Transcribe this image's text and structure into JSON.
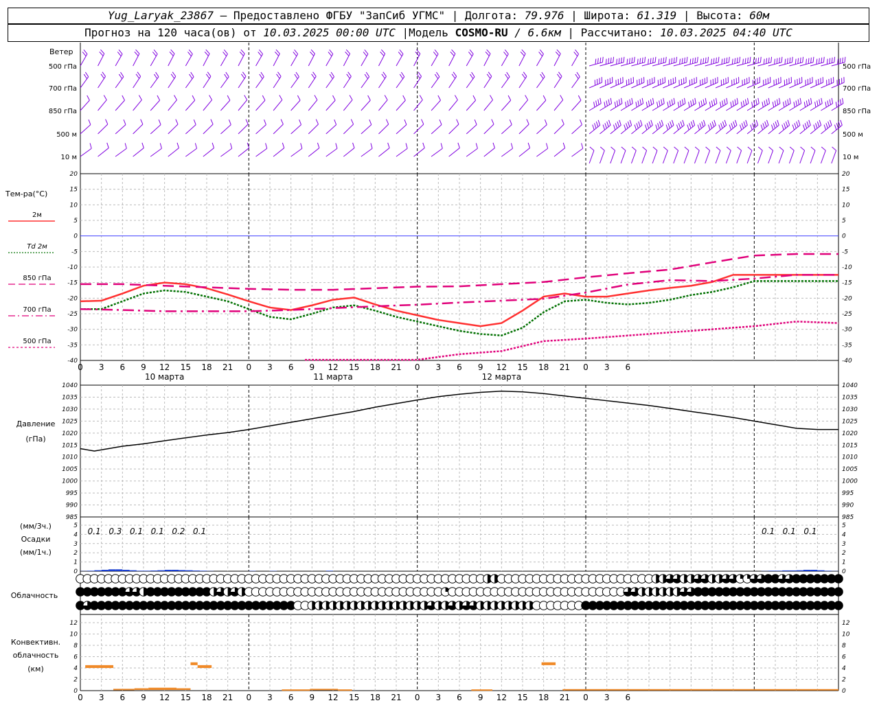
{
  "header": {
    "station": "Yug_Laryak_23867",
    "dash": " — ",
    "provided": "Предоставлено ФГБУ \"ЗапСиб УГМС\"",
    "sep": " | ",
    "lon_label": "Долгота: ",
    "lon_value": "79.976",
    "lat_label": "Широта: ",
    "lat_value": "61.319",
    "alt_label": "Высота: ",
    "alt_value": "60м",
    "forecast_label": "Прогноз на 120 часа(ов) от ",
    "forecast_start": "10.03.2025 00:00 UTC",
    "model_label": "  |Модель ",
    "model_name": "COSMO-RU",
    "model_res_sep": " / ",
    "model_res": "6.6км",
    "calc_label": " | Рассчитано: ",
    "calc_time": "10.03.2025 04:40 UTC"
  },
  "colors": {
    "t2m": "#ff3030",
    "td": "#007000",
    "t850": "#e0007a",
    "t700": "#e0007a",
    "t500": "#e0007a",
    "pressure": "#000000",
    "precip": "#1a3fd0",
    "conv": "#f08a28",
    "wind": "#8000e0",
    "zero": "#4040ff"
  },
  "time_axis": {
    "tick_labels": [
      "0",
      "3",
      "6",
      "9",
      "12",
      "15",
      "18",
      "21",
      "0",
      "3",
      "6",
      "9",
      "12",
      "15",
      "18",
      "21",
      "0",
      "3",
      "6",
      "9",
      "12",
      "15",
      "18",
      "21",
      "0",
      "3",
      "6"
    ],
    "day_labels": [
      "10 марта",
      "11 марта",
      "12 марта"
    ]
  },
  "wind_panel": {
    "title": "Ветер",
    "levels": [
      "500 гПа",
      "700 гПа",
      "850 гПа",
      "500 м",
      "10  м"
    ]
  },
  "temp_panel": {
    "title": "Тем-ра(°C)",
    "legend": [
      {
        "label": "2м",
        "style": "solid",
        "color": "#ff3030"
      },
      {
        "label": "Td  2м",
        "style": "dotted",
        "color": "#007000"
      },
      {
        "label": "850 гПа",
        "style": "dash",
        "color": "#e0007a"
      },
      {
        "label": "700 гПа",
        "style": "dashdot",
        "color": "#e0007a"
      },
      {
        "label": "500 гПа",
        "style": "dot",
        "color": "#e0007a"
      }
    ],
    "y_ticks": [
      "20",
      "15",
      "10",
      "5",
      "0",
      "-5",
      "-10",
      "-15",
      "-20",
      "-25",
      "-30",
      "-35",
      "-40"
    ]
  },
  "pressure_panel": {
    "title_1": "Давление",
    "title_2": "(гПа)",
    "y_ticks": [
      "1040",
      "1035",
      "1030",
      "1025",
      "1020",
      "1015",
      "1010",
      "1005",
      "1000",
      "995",
      "990",
      "985"
    ]
  },
  "precip_panel": {
    "title_1": "(мм/3ч.)",
    "title_2": "Осадки",
    "title_3": "(мм/1ч.)",
    "y_ticks": [
      "5",
      "4",
      "3",
      "2",
      "1",
      "0"
    ],
    "labels": [
      {
        "h": 1,
        "text": "0.1"
      },
      {
        "h": 4,
        "text": "0.3"
      },
      {
        "h": 7,
        "text": "0.1"
      },
      {
        "h": 10,
        "text": "0.1"
      },
      {
        "h": 13,
        "text": "0.2"
      },
      {
        "h": 16,
        "text": "0.1"
      },
      {
        "h": 97,
        "text": "0.1"
      },
      {
        "h": 100,
        "text": "0.1"
      },
      {
        "h": 103,
        "text": "0.1"
      }
    ]
  },
  "cloud_panel": {
    "title": "Облачность"
  },
  "conv_panel": {
    "title_1": "Конвективн.",
    "title_2": "облачность",
    "title_3": "(км)",
    "y_ticks": [
      "12",
      "10",
      "8",
      "6",
      "4",
      "2",
      "0"
    ]
  },
  "chart_data": [
    {
      "type": "line",
      "title": "Тем-ра(°C)",
      "x_unit": "hours from 10.03.2025 00:00 UTC",
      "ylim": [
        -40,
        20
      ],
      "grid": true,
      "series": [
        {
          "name": "2м",
          "x": [
            0,
            3,
            6,
            9,
            12,
            15,
            18,
            21,
            24,
            27,
            30,
            33,
            36,
            39,
            42,
            45,
            48,
            51,
            54,
            57,
            60,
            63,
            66,
            69,
            72,
            75,
            78,
            81,
            84,
            87,
            90,
            93,
            96,
            99,
            102,
            105,
            108
          ],
          "values": [
            -21,
            -20.8,
            -18.5,
            -16,
            -15,
            -15.5,
            -16.8,
            -18.8,
            -21,
            -23,
            -23.8,
            -22.3,
            -20.5,
            -19.8,
            -22,
            -24,
            -25.5,
            -27,
            -28,
            -29,
            -28,
            -24,
            -19.5,
            -18.5,
            -19.5,
            -19.5,
            -18.5,
            -17.5,
            -16.7,
            -16,
            -14.8,
            -12.5,
            -12.5,
            -12.5,
            -12.5,
            -12.5,
            -12.5
          ]
        },
        {
          "name": "Td  2м",
          "x": [
            0,
            3,
            6,
            9,
            12,
            15,
            18,
            21,
            24,
            27,
            30,
            33,
            36,
            39,
            42,
            45,
            48,
            51,
            54,
            57,
            60,
            63,
            66,
            69,
            72,
            75,
            78,
            81,
            84,
            87,
            90,
            93,
            96,
            99,
            102,
            105,
            108
          ],
          "values": [
            -23.5,
            -23.5,
            -21,
            -18.5,
            -17.5,
            -18,
            -19.5,
            -21,
            -23.5,
            -26,
            -26.8,
            -25,
            -23,
            -22.3,
            -24,
            -26,
            -27.5,
            -29,
            -30.5,
            -31.5,
            -32,
            -29.5,
            -24.5,
            -21,
            -20.5,
            -21.5,
            -22,
            -21.5,
            -20.5,
            -19,
            -18,
            -16.5,
            -14.5,
            -14.5,
            -14.5,
            -14.5,
            -14.5
          ]
        },
        {
          "name": "850 гПа",
          "x": [
            0,
            6,
            12,
            18,
            24,
            30,
            36,
            42,
            48,
            54,
            60,
            66,
            72,
            78,
            84,
            90,
            96,
            102,
            108
          ],
          "values": [
            -15.5,
            -15.5,
            -16,
            -16.5,
            -17,
            -17.3,
            -17.3,
            -16.8,
            -16.3,
            -16.2,
            -15.5,
            -14.8,
            -13.3,
            -12,
            -10.8,
            -8.5,
            -6.3,
            -5.8,
            -5.8
          ]
        },
        {
          "name": "700 гПа",
          "x": [
            0,
            6,
            12,
            18,
            24,
            30,
            36,
            42,
            48,
            54,
            60,
            66,
            72,
            78,
            84,
            90,
            96,
            102,
            108
          ],
          "values": [
            -23.5,
            -23.8,
            -24.2,
            -24.2,
            -24.2,
            -23.8,
            -23.2,
            -22.6,
            -22.1,
            -21.4,
            -20.8,
            -20.2,
            -18.2,
            -15.6,
            -14.2,
            -14.5,
            -13.7,
            -12.5,
            -12.5
          ]
        },
        {
          "name": "500 гПа",
          "x": [
            32,
            40,
            48,
            54,
            60,
            66,
            72,
            78,
            84,
            90,
            96,
            102,
            108
          ],
          "values": [
            -39.8,
            -39.8,
            -39.8,
            -38,
            -37,
            -33.8,
            -33,
            -32,
            -31,
            -30,
            -29,
            -27.5,
            -28
          ]
        }
      ]
    },
    {
      "type": "line",
      "title": "Давление (гПа)",
      "ylim": [
        985,
        1040
      ],
      "grid": true,
      "series": [
        {
          "name": "Давление",
          "x": [
            0,
            2,
            4,
            6,
            9,
            12,
            15,
            18,
            21,
            24,
            27,
            30,
            33,
            36,
            39,
            42,
            45,
            48,
            51,
            54,
            57,
            60,
            63,
            66,
            69,
            72,
            75,
            78,
            81,
            84,
            87,
            90,
            93,
            96,
            99,
            102,
            105,
            108
          ],
          "values": [
            1013.5,
            1012.5,
            1013.5,
            1014.5,
            1015.5,
            1016.8,
            1018,
            1019.2,
            1020.2,
            1021.5,
            1023,
            1024.5,
            1026,
            1027.5,
            1029,
            1030.8,
            1032.3,
            1033.8,
            1035.2,
            1036.2,
            1037,
            1037.5,
            1037.2,
            1036.5,
            1035.5,
            1034.5,
            1033.5,
            1032.5,
            1031.5,
            1030.3,
            1029,
            1027.8,
            1026.5,
            1025,
            1023.5,
            1022,
            1021.5,
            1021.5
          ]
        }
      ]
    },
    {
      "type": "bar",
      "title": "Осадки (мм/1ч.)",
      "ylim": [
        0,
        5
      ],
      "grid": true,
      "x": [
        0,
        1,
        2,
        3,
        4,
        5,
        6,
        7,
        8,
        9,
        10,
        11,
        12,
        13,
        14,
        15,
        16,
        17,
        18,
        24,
        27,
        35,
        97,
        98,
        99,
        100,
        101,
        102,
        103,
        104,
        105,
        106,
        107
      ],
      "values": [
        0.02,
        0.05,
        0.1,
        0.15,
        0.2,
        0.2,
        0.15,
        0.1,
        0.05,
        0.05,
        0.07,
        0.1,
        0.15,
        0.15,
        0.12,
        0.1,
        0.07,
        0.05,
        0.02,
        0.03,
        0.03,
        0.05,
        0.02,
        0.05,
        0.05,
        0.08,
        0.08,
        0.1,
        0.15,
        0.15,
        0.1,
        0.05,
        0.02
      ]
    },
    {
      "type": "bar",
      "title": "Конвективн. облачность (км)",
      "ylim": [
        0,
        12
      ],
      "grid": true,
      "series": [
        {
          "values_range": [
            {
              "x0": 0.7,
              "x1": 4.7,
              "base": 4,
              "top": 4.5
            },
            {
              "x0": 15.7,
              "x1": 16.7,
              "base": 4.5,
              "top": 5
            },
            {
              "x0": 16.7,
              "x1": 18.7,
              "base": 4,
              "top": 4.5
            },
            {
              "x0": 65.7,
              "x1": 67.7,
              "base": 4.5,
              "top": 5
            },
            {
              "x0": 4.7,
              "x1": 7.7,
              "base": 0,
              "top": 0.2
            },
            {
              "x0": 7.7,
              "x1": 9.7,
              "base": 0,
              "top": 0.3
            },
            {
              "x0": 9.7,
              "x1": 13.7,
              "base": 0,
              "top": 0.4
            },
            {
              "x0": 13.7,
              "x1": 15.7,
              "base": 0,
              "top": 0.3
            },
            {
              "x0": 28.7,
              "x1": 32.7,
              "base": 0,
              "top": 0.1
            },
            {
              "x0": 32.7,
              "x1": 36.7,
              "base": 0,
              "top": 0.2
            },
            {
              "x0": 36.7,
              "x1": 38.7,
              "base": 0,
              "top": 0.1
            },
            {
              "x0": 55.7,
              "x1": 58.7,
              "base": 0,
              "top": 0.1
            },
            {
              "x0": 68.7,
              "x1": 108,
              "base": 0,
              "top": 0.15
            }
          ]
        }
      ]
    },
    {
      "type": "table",
      "title": "Облачность",
      "rows_fraction": [
        {
          "level": "upper",
          "x": [
            0,
            24,
            48,
            58,
            60,
            62,
            64,
            66,
            68,
            70,
            72,
            74,
            76,
            78,
            80,
            82,
            84,
            86,
            88,
            90,
            92,
            94,
            96,
            98,
            100,
            102,
            104,
            106,
            108
          ],
          "values": [
            0,
            0,
            0,
            0.5,
            0,
            0,
            0,
            0,
            0,
            0,
            0,
            0,
            0,
            0,
            0,
            0.5,
            0.75,
            0.5,
            0.75,
            0.5,
            0.75,
            0.25,
            0.75,
            1,
            0.75,
            1,
            1,
            1,
            1
          ]
        },
        {
          "level": "middle",
          "x": [
            0,
            6,
            7,
            8,
            9,
            10,
            11,
            12,
            18,
            19,
            20,
            21,
            22,
            23,
            24,
            48,
            52,
            53,
            56,
            60,
            72,
            76,
            78,
            80,
            82,
            84,
            86,
            88,
            90,
            92,
            94,
            96,
            98,
            100,
            102,
            104,
            106,
            108
          ],
          "values": [
            1,
            1,
            0.75,
            0.75,
            0.5,
            1,
            1,
            1,
            1,
            0.5,
            0.75,
            0.5,
            0.75,
            0.5,
            0,
            0,
            0.25,
            0,
            0,
            0,
            0,
            0,
            0.75,
            0.5,
            0.5,
            0.5,
            0.75,
            1,
            1,
            1,
            1,
            1,
            1,
            1,
            1,
            1,
            1,
            1
          ]
        },
        {
          "level": "lower",
          "x": [
            0,
            1,
            2,
            3,
            4,
            5,
            6,
            7,
            8,
            9,
            10,
            11,
            12,
            13,
            14,
            15,
            16,
            17,
            18,
            19,
            20,
            21,
            22,
            23,
            24,
            30,
            31,
            32,
            33,
            34,
            35,
            36,
            37,
            38,
            39,
            40,
            41,
            42,
            43,
            44,
            45,
            46,
            47,
            48,
            49,
            50,
            51,
            52,
            53,
            54,
            55,
            56,
            57,
            58,
            59,
            60,
            61,
            62,
            63,
            64,
            65,
            66,
            67,
            68,
            69,
            70,
            71,
            72,
            80,
            108
          ],
          "values": [
            1,
            0.75,
            1,
            1,
            1,
            1,
            1,
            1,
            1,
            1,
            1,
            1,
            1,
            1,
            1,
            1,
            1,
            1,
            1,
            1,
            1,
            1,
            1,
            1,
            1,
            1,
            0,
            0,
            0.5,
            0.5,
            0.5,
            0.5,
            0.5,
            0.5,
            0.5,
            0.5,
            0.5,
            0.5,
            0.5,
            0.5,
            0.5,
            0.5,
            0.5,
            0.5,
            0.5,
            0.75,
            0.5,
            0.5,
            0.75,
            0.5,
            0.75,
            0.75,
            0.5,
            0.5,
            0.5,
            0.5,
            0.5,
            0.5,
            0.5,
            0.5,
            0,
            0,
            0,
            0,
            0,
            0,
            0,
            1,
            1,
            1
          ]
        }
      ]
    }
  ]
}
